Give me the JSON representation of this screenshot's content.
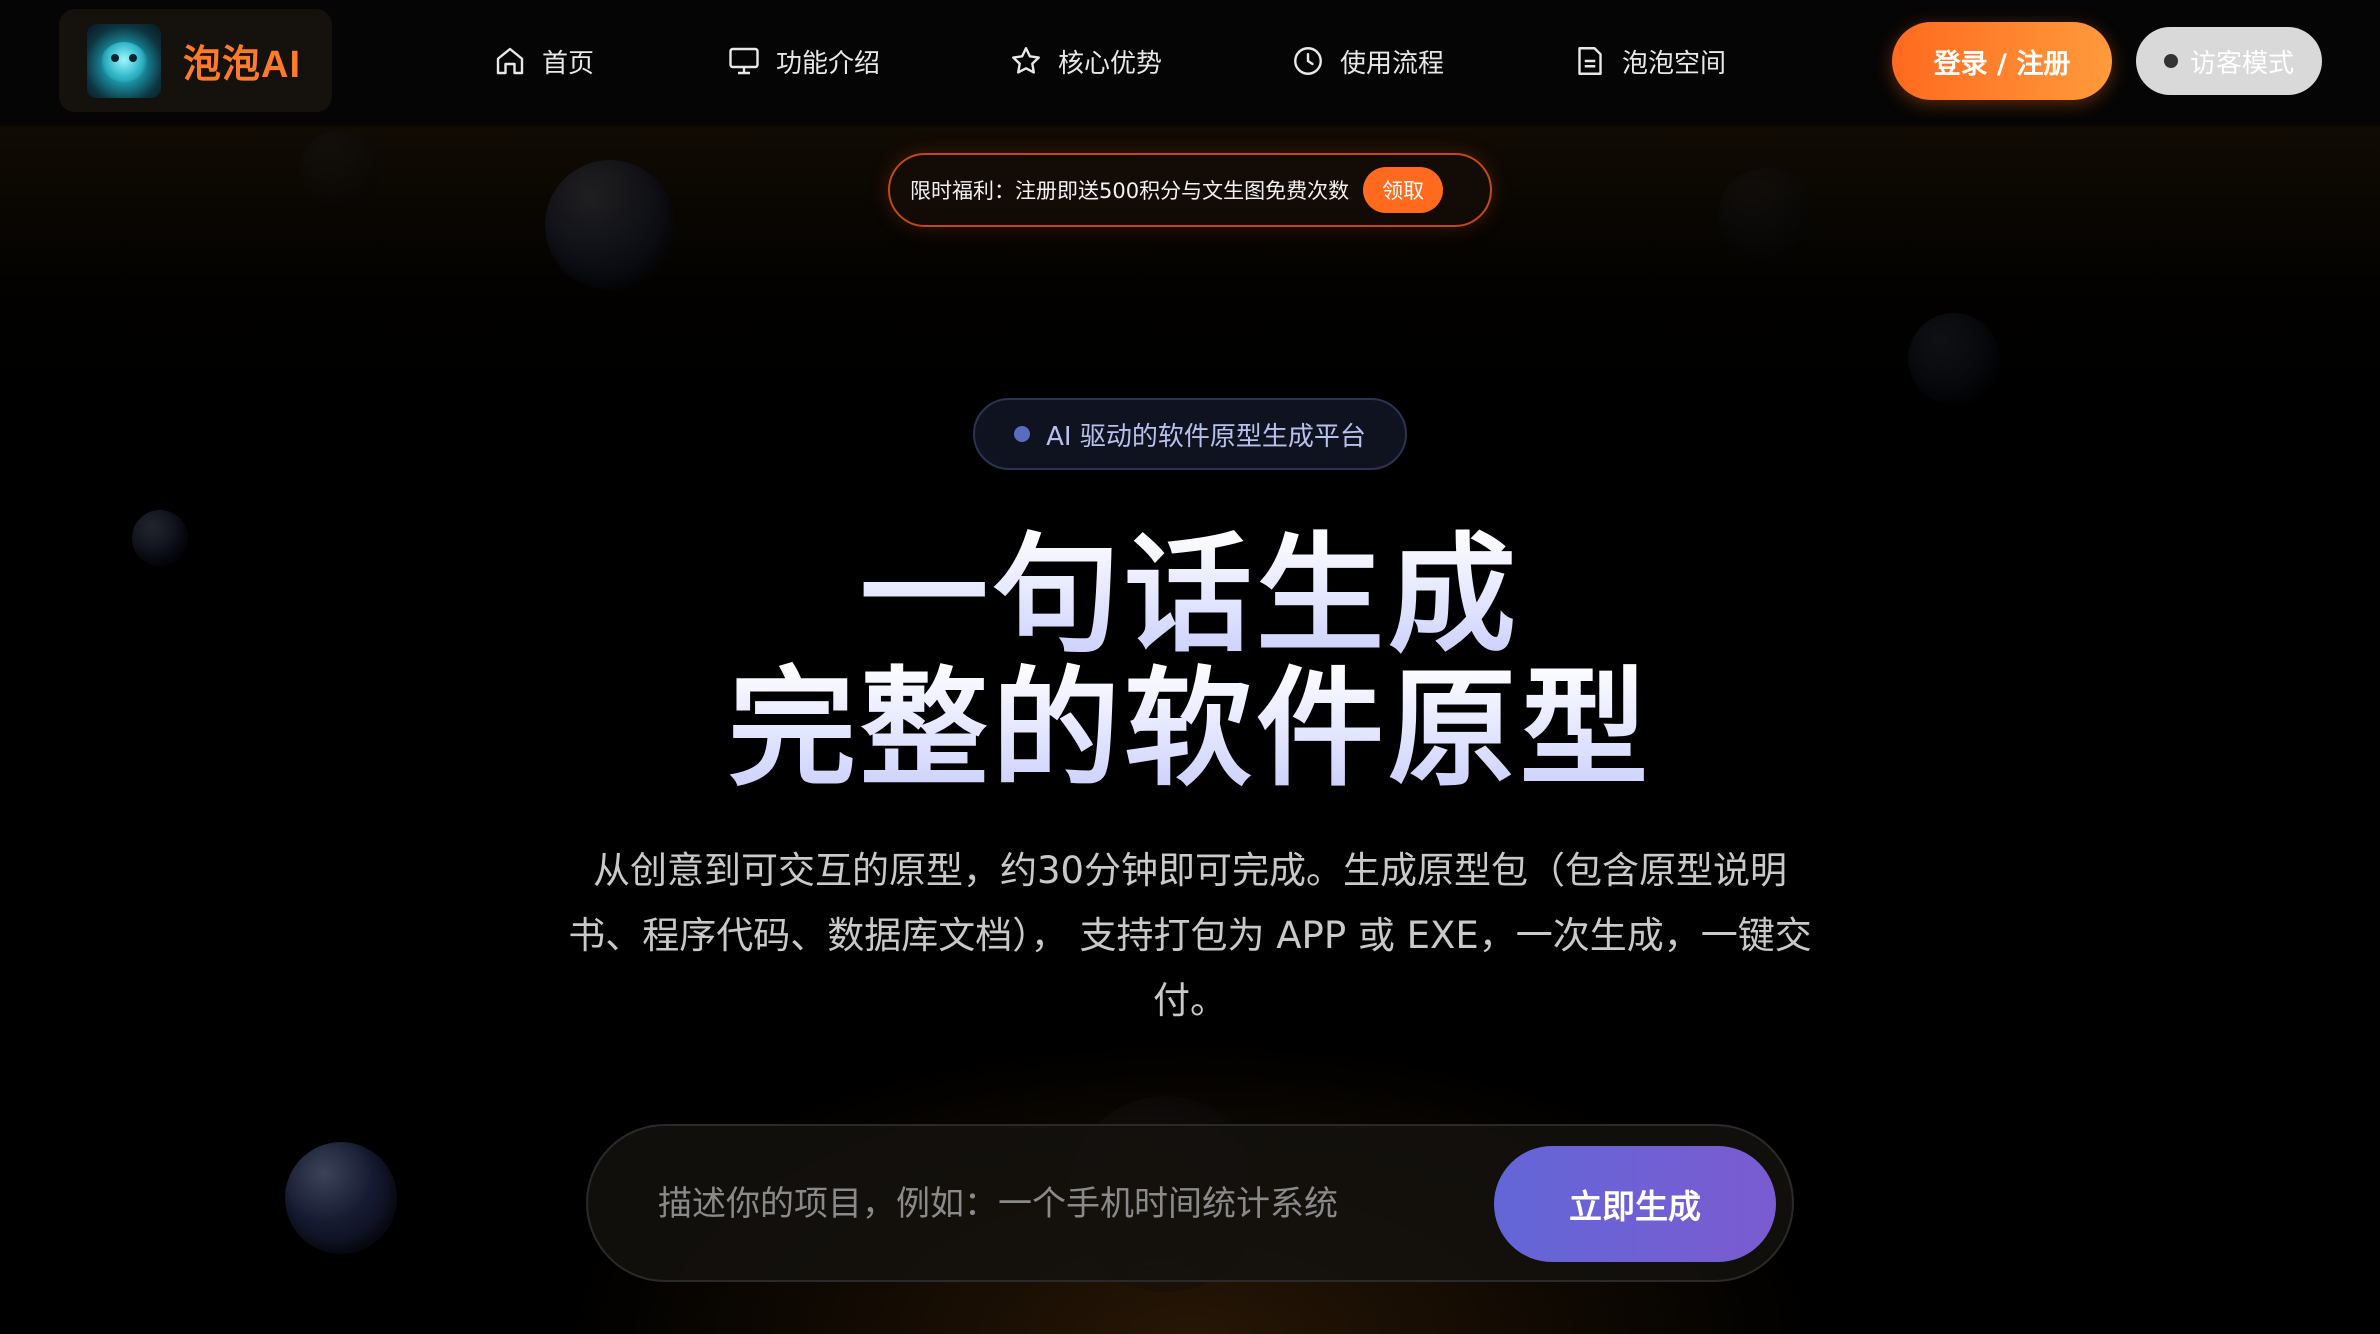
{
  "brand": {
    "name": "泡泡AI",
    "accent": "#ff7a2a"
  },
  "nav": {
    "items": [
      {
        "label": "首页",
        "icon": "home-icon"
      },
      {
        "label": "功能介绍",
        "icon": "monitor-icon"
      },
      {
        "label": "核心优势",
        "icon": "star-icon"
      },
      {
        "label": "使用流程",
        "icon": "clock-icon"
      },
      {
        "label": "泡泡空间",
        "icon": "document-icon"
      }
    ],
    "login_label": "登录 / 注册",
    "guest_label": "访客模式"
  },
  "promo": {
    "text": "限时福利：注册即送500积分与文生图免费次数",
    "button_label": "领取"
  },
  "hero": {
    "tag": "AI 驱动的软件原型生成平台",
    "title_line1": "一句话生成",
    "title_line2": "完整的软件原型",
    "subtitle": "从创意到可交互的原型，约30分钟即可完成。生成原型包（包含原型说明书、程序代码、数据库文档）， 支持打包为 APP 或 EXE，一次生成，一键交付。"
  },
  "generator": {
    "placeholder": "描述你的项目，例如：一个手机时间统计系统",
    "value": "",
    "button_label": "立即生成"
  },
  "colors": {
    "primary_orange": "#ff6a1f",
    "generate_purple": "#6c62d6",
    "background": "#000000"
  }
}
